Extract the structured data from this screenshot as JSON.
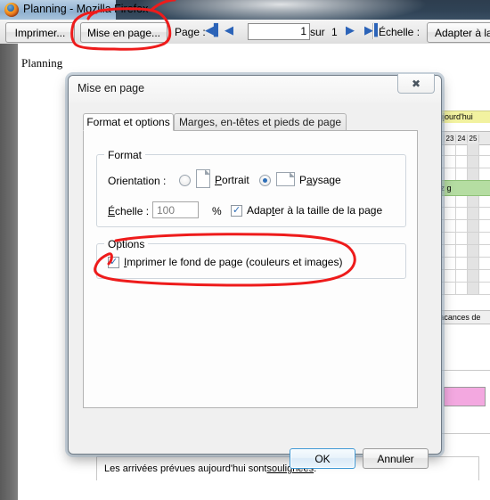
{
  "window": {
    "title": "Planning - Mozilla Firefox",
    "icon": "firefox-icon"
  },
  "toolbar": {
    "print_label": "Imprimer...",
    "page_setup_label": "Mise en page...",
    "page_label": "Page :",
    "page_value": "1",
    "of_label": "sur",
    "total_pages": "1",
    "scale_label": "Échelle :",
    "scale_value": "Adapter à la p",
    "nav_first_icon": "first-page-icon",
    "nav_prev_icon": "previous-page-icon",
    "nav_next_icon": "next-page-icon",
    "nav_last_icon": "last-page-icon"
  },
  "page": {
    "heading": "Planning",
    "footer_note_prefix": "Les arrivées prévues aujourd'hui sont ",
    "footer_note_underlined": "soulignées",
    "footer_note_suffix": ".",
    "background": {
      "today_label": "aujourd'hui",
      "day_numbers": [
        "2",
        "23",
        "24",
        "25"
      ],
      "green_row_label": "jzz g",
      "vacation_label": "Vacances de",
      "highlight_color": "#f3a8e0",
      "today_color": "#f2f2a0",
      "green_color": "#b5dda2"
    }
  },
  "dialog": {
    "title": "Mise en page",
    "close_icon": "close-icon",
    "tabs": [
      {
        "label": "Format et options",
        "active": true
      },
      {
        "label": "Marges, en-têtes et pieds de page",
        "active": false
      }
    ],
    "format_group": {
      "legend": "Format",
      "orientation_label": "Orientation :",
      "portrait_label": "Portrait",
      "portrait_selected": false,
      "landscape_label": "Paysage",
      "landscape_selected": true,
      "scale_label": "Échelle :",
      "scale_value": "100",
      "percent_label": "%",
      "shrink_label": "Adapter à la taille de la page",
      "shrink_checked": true
    },
    "options_group": {
      "legend": "Options",
      "print_background_label": "Imprimer le fond de page (couleurs et images)",
      "print_background_checked": true
    },
    "ok_label": "OK",
    "cancel_label": "Annuler"
  },
  "annotations": {
    "ink_color": "#ee1b1b",
    "marks": [
      "circle-around-page-setup-button",
      "circle-around-print-background-checkbox"
    ]
  }
}
